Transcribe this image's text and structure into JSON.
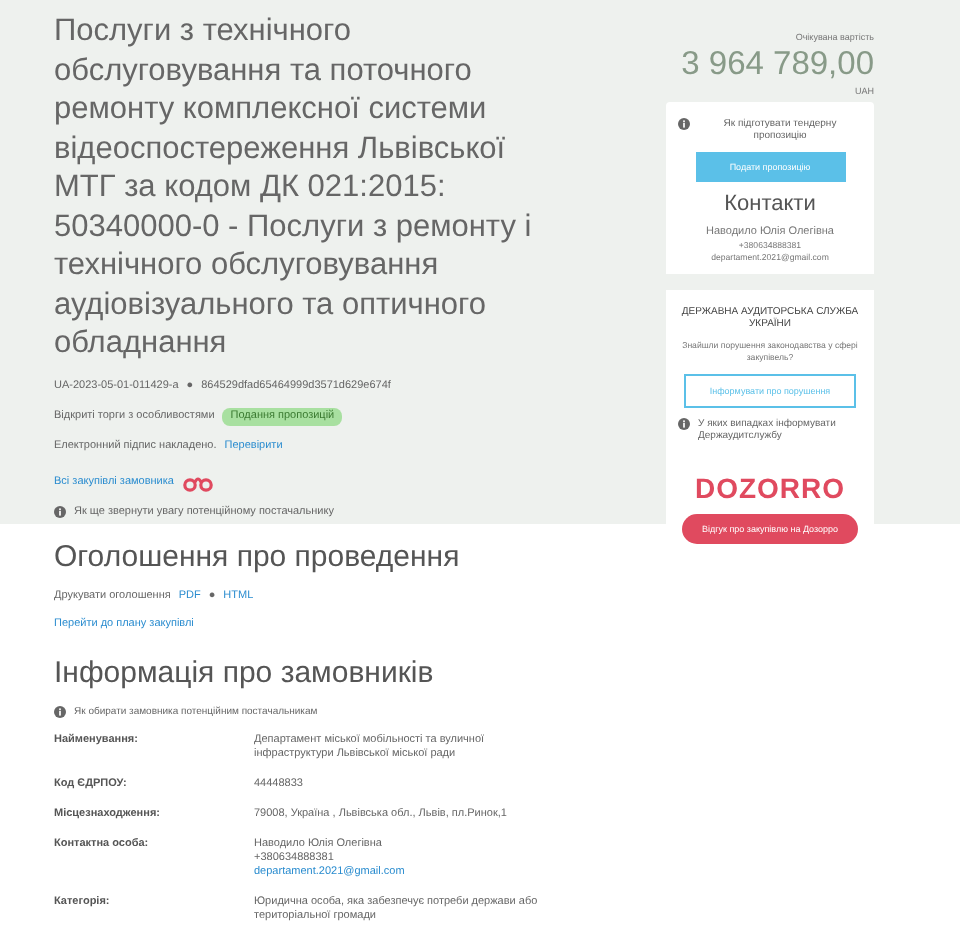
{
  "tender": {
    "title": "Послуги з технічного обслуговування та поточного ремонту комплексної системи відеоспостереження Львівської МТГ за кодом ДК 021:2015: 50340000-0 - Послуги з ремонту і технічного обслуговування аудіовізуального та оптичного обладнання",
    "id": "UA-2023-05-01-011429-a",
    "separator": "●",
    "hash": "864529dfad65464999d3571d629e674f",
    "procedure": "Відкриті торги з особливостями",
    "status": "Подання пропозицій",
    "signature": "Електронний підпис накладено.",
    "verify_link": "Перевірити",
    "all_purchases_link": "Всі закупівлі замовника",
    "attention_hint": "Як ще звернути увагу потенційному постачальнику"
  },
  "price": {
    "label": "Очікувана вартість",
    "amount": "3 964 789,00",
    "currency": "UAH"
  },
  "sidebar": {
    "bid_hint": "Як підготувати тендерну пропозицію",
    "bid_button": "Подати пропозицію",
    "contacts_title": "Контакти",
    "contact_name": "Наводило Юлія Олегівна",
    "contact_phone": "+380634888381",
    "contact_email": "departament.2021@gmail.com",
    "audit_title": "ДЕРЖАВНА АУДИТОРСЬКА СЛУЖБА УКРАЇНИ",
    "audit_question": "Знайшли порушення законодавства у сфері закупівель?",
    "audit_button": "Інформувати про порушення",
    "audit_hint": "У яких випадках інформувати Держаудитслужбу",
    "dozorro_logo": "DOZORRO",
    "dozorro_button": "Відгук про закупівлю на Дозорро"
  },
  "announcement": {
    "title": "Оголошення про проведення",
    "print_label": "Друкувати оголошення",
    "print_links": [
      "PDF",
      "HTML"
    ],
    "separator": "●",
    "plan_link": "Перейти до плану закупівлі"
  },
  "customer": {
    "title": "Інформація про замовників",
    "hint": "Як обирати замовника потенційним постачальникам",
    "rows": [
      {
        "label": "Найменування:",
        "lines": [
          {
            "text": "Департамент міської мобільності та вуличної інфраструктури Львівської міської ради",
            "kind": "text"
          }
        ]
      },
      {
        "label": "Код ЄДРПОУ:",
        "lines": [
          {
            "text": "44448833",
            "kind": "text"
          }
        ]
      },
      {
        "label": "Місцезнаходження:",
        "lines": [
          {
            "text": "79008, Україна , Львівська обл., Львів, пл.Ринок,1",
            "kind": "text"
          }
        ]
      },
      {
        "label": "Контактна особа:",
        "lines": [
          {
            "text": "Наводило Юлія Олегівна",
            "kind": "text"
          },
          {
            "text": "+380634888381",
            "kind": "text"
          },
          {
            "text": "departament.2021@gmail.com",
            "kind": "link"
          }
        ]
      },
      {
        "label": "Категорія:",
        "lines": [
          {
            "text": "Юридична особа, яка забезпечує потреби держави або територіальної громади",
            "kind": "text"
          }
        ]
      }
    ]
  }
}
